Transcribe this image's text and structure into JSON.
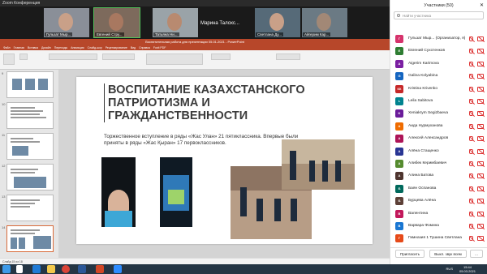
{
  "window": {
    "title": "Zoom Конференция"
  },
  "video_strip": [
    {
      "name": "Гульзат Мыр..."
    },
    {
      "name": "Евгений Стру..."
    },
    {
      "name": "Татьяна Ни..."
    },
    {
      "name": "Марина Талохс..."
    },
    {
      "name": "Светлана Ду..."
    },
    {
      "name": "Айгерим Кар..."
    }
  ],
  "powerpoint": {
    "title": "Воспитательная работа для презентации 05.01.2021 - PowerPoint",
    "tabs": [
      "Файл",
      "Главная",
      "Вставка",
      "Дизайн",
      "Переходы",
      "Анимация",
      "Слайд-шоу",
      "Рецензирование",
      "Вид",
      "Справка",
      "Foxit PDF"
    ],
    "slide_numbers": [
      "9",
      "10",
      "11",
      "12",
      "13",
      "14"
    ],
    "status": "Слайд 15 из 18"
  },
  "slide": {
    "title": "Воспитание казахстанского патриотизма и гражданственности",
    "body": "Торжественное вступление в ряды «Жас Улан» 21 пятиклассника. Впервые были приняты в ряды «Жас Қыран» 17 первоклассников."
  },
  "panel": {
    "title": "Участники (50)",
    "search_placeholder": "Найти участника",
    "participants": [
      {
        "initial": "Г",
        "color": "#d6336c",
        "name": "Гульзат Мыр... (Организатор, я)"
      },
      {
        "initial": "Е",
        "color": "#2e7d32",
        "name": "Евгений Сухотенков"
      },
      {
        "initial": "А",
        "color": "#7b1fa2",
        "name": "Aigerim Karimova"
      },
      {
        "initial": "G",
        "color": "#1565c0",
        "name": "Galina Kolyabina"
      },
      {
        "initial": "КК",
        "color": "#c62828",
        "name": "Kristina Krivenko"
      },
      {
        "initial": "L",
        "color": "#00838f",
        "name": "Leila Sabitova"
      },
      {
        "initial": "K",
        "color": "#6a1b9a",
        "name": "Xeniakrym Segizbaeva"
      },
      {
        "initial": "А",
        "color": "#ef6c00",
        "name": "Аида Нурмуханова"
      },
      {
        "initial": "А",
        "color": "#ad1457",
        "name": "Алексей Александров"
      },
      {
        "initial": "А",
        "color": "#283593",
        "name": "Алёна Стащенко"
      },
      {
        "initial": "А",
        "color": "#558b2f",
        "name": "Алибек Керимбаевич"
      },
      {
        "initial": "А",
        "color": "#4e342e",
        "name": "Алина Батова"
      },
      {
        "initial": "Б",
        "color": "#00695c",
        "name": "Баян Оспанова"
      },
      {
        "initial": "Б",
        "color": "#5d4037",
        "name": "Бурцева Алёна"
      },
      {
        "initial": "В",
        "color": "#c2185b",
        "name": "Валентина"
      },
      {
        "initial": "В",
        "color": "#1976d2",
        "name": "Варвара Фомина"
      },
      {
        "initial": "Г",
        "color": "#e64a19",
        "name": "Гимназия 1 Тушина Светлана"
      }
    ],
    "invite_label": "Пригласить",
    "mute_all_label": "Выкл. звук всем",
    "more_label": "..."
  },
  "taskbar": {
    "time": "15:44",
    "date": "05.03.2021",
    "lang": "RUS"
  }
}
